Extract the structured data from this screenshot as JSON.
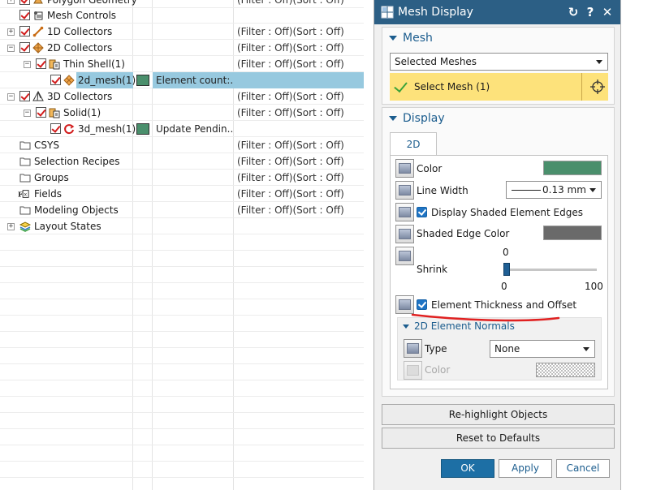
{
  "navigator": {
    "rows": [
      {
        "label": "Polygon Geometry",
        "filter": "(Filter : Off)(Sort : Off)"
      },
      {
        "label": "Mesh Controls",
        "filter": ""
      },
      {
        "label": "1D Collectors",
        "filter": "(Filter : Off)(Sort : Off)"
      },
      {
        "label": "2D Collectors",
        "filter": "(Filter : Off)(Sort : Off)"
      },
      {
        "label": "Thin Shell(1)",
        "filter": "(Filter : Off)(Sort : Off)"
      },
      {
        "label": "2d_mesh(1)",
        "info": "Element count:...",
        "filter": ""
      },
      {
        "label": "3D Collectors",
        "filter": "(Filter : Off)(Sort : Off)"
      },
      {
        "label": "Solid(1)",
        "filter": "(Filter : Off)(Sort : Off)"
      },
      {
        "label": "3d_mesh(1)",
        "info": "Update Pendin...",
        "filter": ""
      },
      {
        "label": "CSYS",
        "filter": "(Filter : Off)(Sort : Off)"
      },
      {
        "label": "Selection Recipes",
        "filter": "(Filter : Off)(Sort : Off)"
      },
      {
        "label": "Groups",
        "filter": "(Filter : Off)(Sort : Off)"
      },
      {
        "label": "Fields",
        "filter": "(Filter : Off)(Sort : Off)"
      },
      {
        "label": "Modeling Objects",
        "filter": "(Filter : Off)(Sort : Off)"
      },
      {
        "label": "Layout States",
        "filter": ""
      }
    ]
  },
  "dialog": {
    "title": "Mesh Display",
    "title_buttons": {
      "reset": "↻",
      "help": "?",
      "close": "✕"
    },
    "mesh_group": {
      "title": "Mesh",
      "selector_value": "Selected Meshes",
      "select_label": "Select Mesh (1)"
    },
    "display_group": {
      "title": "Display",
      "tab_label": "2D",
      "color_label": "Color",
      "color_value": "#4a8f6c",
      "line_width_label": "Line Width",
      "line_width_value": "0.13 mm",
      "shaded_edges_label": "Display Shaded Element Edges",
      "shaded_edges_checked": true,
      "shaded_edge_color_label": "Shaded Edge Color",
      "shaded_edge_color_value": "#6a6a6a",
      "shrink_label": "Shrink",
      "shrink_value": "0",
      "shrink_min": "0",
      "shrink_max": "100",
      "thickness_label": "Element Thickness and Offset",
      "thickness_checked": true,
      "normals": {
        "title": "2D Element Normals",
        "type_label": "Type",
        "type_value": "None",
        "color_label": "Color"
      }
    },
    "rehighlight_label": "Re-highlight Objects",
    "reset_label": "Reset to Defaults",
    "ok_label": "OK",
    "apply_label": "Apply",
    "cancel_label": "Cancel"
  },
  "colors": {
    "accent": "#1c5d8e",
    "titlebar": "#2c5f85",
    "mesh_swatch": "#4a8f6c",
    "selection_highlight": "#97c9df",
    "select_mesh_bg": "#fde27b",
    "annotation_underline": "#e02020"
  }
}
